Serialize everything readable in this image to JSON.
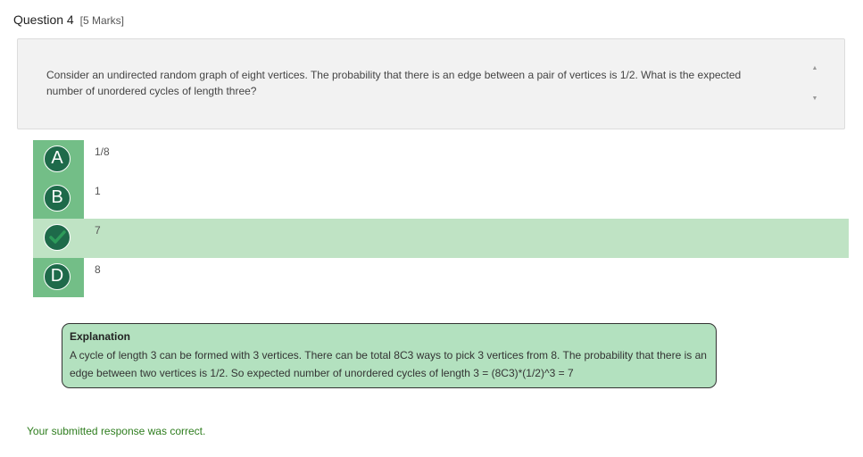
{
  "question": {
    "number_label": "Question 4",
    "marks_label": "[5 Marks]",
    "text": "Consider an undirected random graph of eight vertices. The probability that there is an edge between a pair of vertices is 1/2. What is the expected number of unordered cycles of length three?"
  },
  "options": [
    {
      "letter": "A",
      "text": "1/8",
      "correct": false
    },
    {
      "letter": "B",
      "text": "1",
      "correct": false
    },
    {
      "letter": "C",
      "text": "7",
      "correct": true
    },
    {
      "letter": "D",
      "text": "8",
      "correct": false
    }
  ],
  "explanation": {
    "title": "Explanation",
    "body": "A cycle of length 3 can be formed with 3 vertices. There can be total 8C3 ways to pick 3 vertices from 8. The probability that there is an edge between two vertices is 1/2. So expected number of unordered cycles of length 3 = (8C3)*(1/2)^3 = 7"
  },
  "feedback": "Your submitted response was correct.",
  "icons": {
    "scroll_up": "triangle-up-icon",
    "scroll_down": "triangle-down-icon",
    "correct": "check-icon"
  },
  "colors": {
    "correct_row": "#bfe3c4",
    "option_column": "#73be87",
    "letter_badge": "#1e6a4a",
    "explanation_bg": "#b3e1bf",
    "feedback_text": "#2e7d1e"
  }
}
